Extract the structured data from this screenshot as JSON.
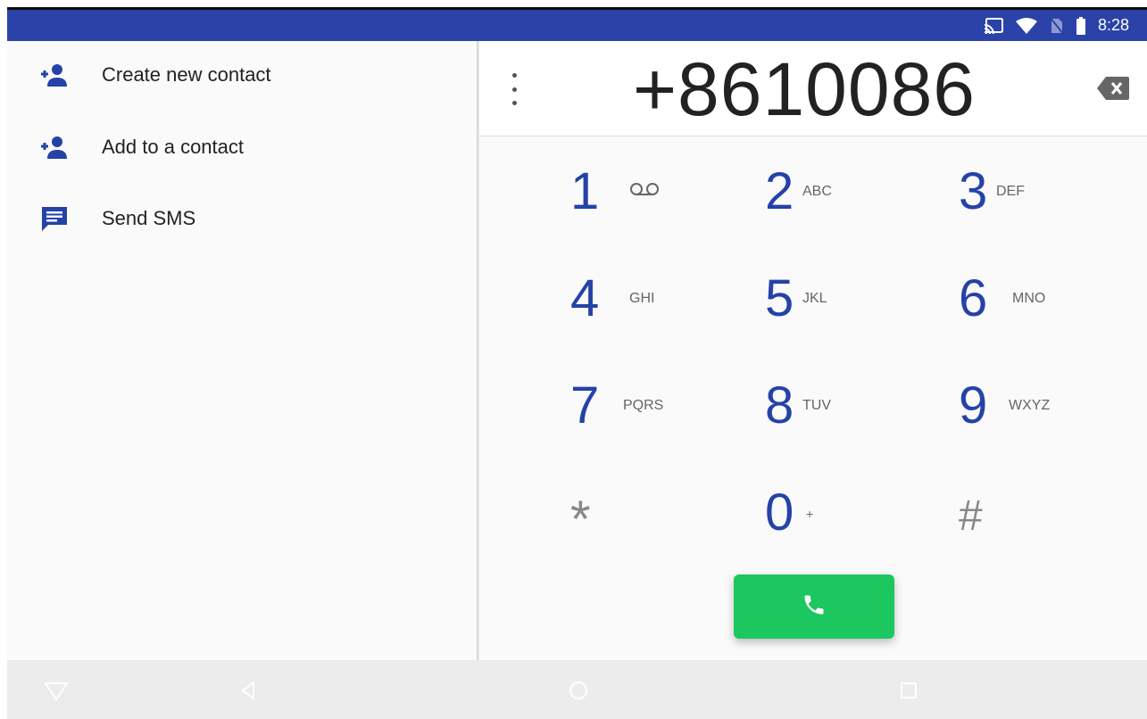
{
  "status_bar": {
    "time": "8:28",
    "icons": [
      "cast-icon",
      "wifi-icon",
      "no-sim-icon",
      "battery-icon"
    ]
  },
  "options_menu": {
    "items": [
      {
        "label": "Create new contact",
        "icon": "add-person-icon"
      },
      {
        "label": "Add to a contact",
        "icon": "add-person-icon"
      },
      {
        "label": "Send SMS",
        "icon": "message-icon"
      }
    ]
  },
  "dialer": {
    "number": "+8610086",
    "keys": [
      {
        "digit": "1",
        "letters": ""
      },
      {
        "digit": "2",
        "letters": "ABC"
      },
      {
        "digit": "3",
        "letters": "DEF"
      },
      {
        "digit": "4",
        "letters": "GHI"
      },
      {
        "digit": "5",
        "letters": "JKL"
      },
      {
        "digit": "6",
        "letters": "MNO"
      },
      {
        "digit": "7",
        "letters": "PQRS"
      },
      {
        "digit": "8",
        "letters": "TUV"
      },
      {
        "digit": "9",
        "letters": "WXYZ"
      },
      {
        "digit": "*",
        "letters": ""
      },
      {
        "digit": "0",
        "letters": "+"
      },
      {
        "digit": "#",
        "letters": ""
      }
    ]
  },
  "colors": {
    "status_bar": "#2b43a8",
    "accent": "#2442a8",
    "call_button": "#1cc760"
  }
}
